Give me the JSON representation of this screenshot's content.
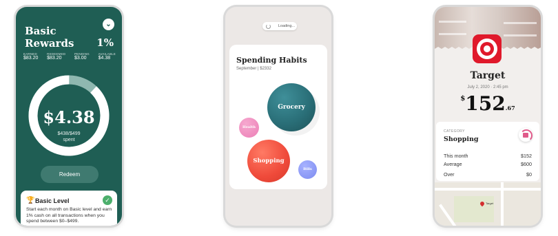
{
  "rewards": {
    "title_line1": "Basic",
    "title_line2": "Rewards",
    "percent": "1%",
    "stats": [
      {
        "label": "EARNED",
        "value": "$83.20"
      },
      {
        "label": "REDEEMED",
        "value": "$83.20"
      },
      {
        "label": "PENDING",
        "value": "$3.00"
      },
      {
        "label": "AVAILABLE",
        "value": "$4.38"
      }
    ],
    "ring_amount": "$4.38",
    "ring_spent": "$438/$499",
    "ring_spent_label": "spent",
    "ring_progress": 0.88,
    "redeem_label": "Redeem",
    "level_title": "Basic Level",
    "level_desc": "Start each month on Basic level and earn 1% cash on all transactions when you spend between $0–$499.",
    "colors": {
      "bg": "#1f5e54",
      "ring_track": "#8fb8b0",
      "check": "#4caf6c"
    }
  },
  "habits": {
    "loading_label": "Loading...",
    "title": "Spending Habits",
    "subtitle": "September | $2332",
    "bubbles": [
      {
        "label": "Grocery",
        "color": "#2a6f78"
      },
      {
        "label": "Health",
        "color": "#ec7fb6"
      },
      {
        "label": "Shopping",
        "color": "#ef4a3a"
      },
      {
        "label": "Bills",
        "color": "#7d8cf0"
      }
    ]
  },
  "merchant": {
    "name": "Target",
    "date": "July 2, 2020 · 2:45 pm",
    "amount_symbol": "$",
    "amount_whole": "152",
    "amount_cents": ".67",
    "category_label": "CATEGORY",
    "category": "Shopping",
    "rows": [
      {
        "label": "This month",
        "value": "$152"
      },
      {
        "label": "Average",
        "value": "$600"
      },
      {
        "label": "Over",
        "value": "$0"
      }
    ],
    "map_pin_label": "Target",
    "brand_color": "#e0192b"
  }
}
